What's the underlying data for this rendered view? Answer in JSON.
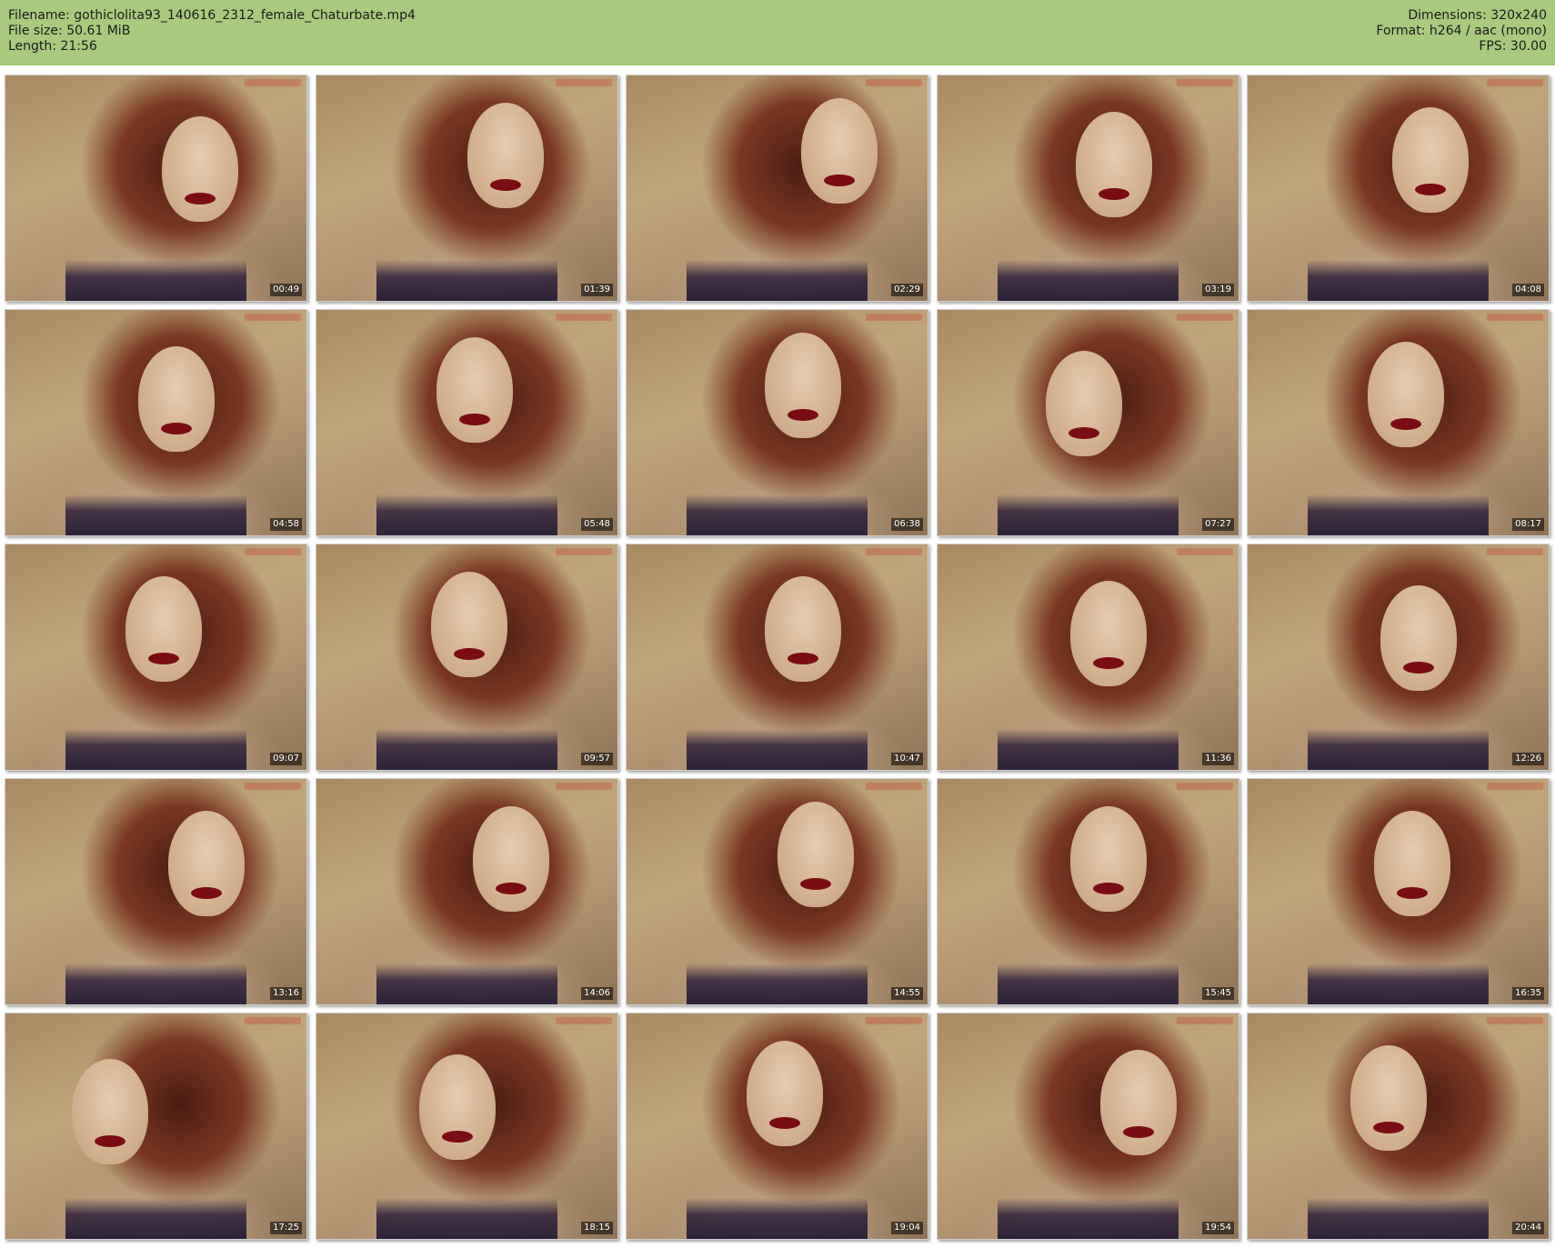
{
  "header": {
    "filename_line": "Filename: gothiclolita93_140616_2312_female_Chaturbate.mp4",
    "filesize_line": "File size: 50.61 MiB",
    "length_line": "Length: 21:56",
    "dimensions_line": "Dimensions: 320x240",
    "format_line": "Format: h264 / aac (mono)",
    "fps_line": "FPS: 30.00"
  },
  "colors": {
    "header_bg": "#a9c97e",
    "timestamp_text": "#ffffff"
  },
  "thumbnails": [
    {
      "time": "00:49"
    },
    {
      "time": "01:39"
    },
    {
      "time": "02:29"
    },
    {
      "time": "03:19"
    },
    {
      "time": "04:08"
    },
    {
      "time": "04:58"
    },
    {
      "time": "05:48"
    },
    {
      "time": "06:38"
    },
    {
      "time": "07:27"
    },
    {
      "time": "08:17"
    },
    {
      "time": "09:07"
    },
    {
      "time": "09:57"
    },
    {
      "time": "10:47"
    },
    {
      "time": "11:36"
    },
    {
      "time": "12:26"
    },
    {
      "time": "13:16"
    },
    {
      "time": "14:06"
    },
    {
      "time": "14:55"
    },
    {
      "time": "15:45"
    },
    {
      "time": "16:35"
    },
    {
      "time": "17:25"
    },
    {
      "time": "18:15"
    },
    {
      "time": "19:04"
    },
    {
      "time": "19:54"
    },
    {
      "time": "20:44"
    }
  ]
}
